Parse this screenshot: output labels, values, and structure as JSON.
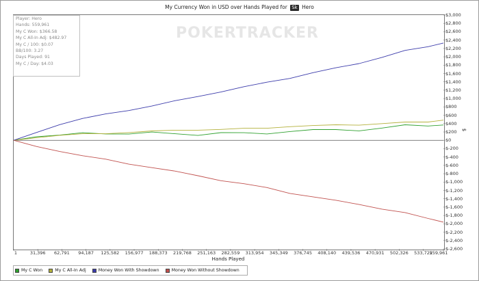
{
  "window": {
    "title_prefix": "My Currency Won in USD over Hands Played for",
    "site_badge": "Sk",
    "title_suffix": "Hero"
  },
  "watermark": "POKERTRACKER",
  "stats": [
    "Player: Hero",
    "Hands: 559,961",
    "My C Won: $366.58",
    "My C All-In Adj: $482.97",
    "My C / 100: $0.07",
    "BB/100: 3.27",
    "Days Played: 91",
    "My C / Day: $4.03"
  ],
  "chart_data": {
    "type": "line",
    "title": "My Currency Won in USD over Hands Played for Sk Hero",
    "xlabel": "Hands Played",
    "ylabel": "$",
    "xlim": [
      1,
      559961
    ],
    "ylim": [
      -2600,
      3000
    ],
    "x_ticks": [
      "1",
      "31,396",
      "62,791",
      "94,187",
      "125,582",
      "156,977",
      "188,373",
      "219,768",
      "251,163",
      "282,559",
      "313,954",
      "345,349",
      "376,745",
      "408,140",
      "439,536",
      "470,931",
      "502,326",
      "533,722",
      "559,961"
    ],
    "y_ticks": [
      "$3,000",
      "$2,800",
      "$2,600",
      "$2,400",
      "$2,200",
      "$2,000",
      "$1,800",
      "$1,600",
      "$1,400",
      "$1,200",
      "$1,000",
      "$800",
      "$600",
      "$400",
      "$200",
      "$0",
      "$-200",
      "$-400",
      "$-600",
      "$-800",
      "$-1,000",
      "$-1,200",
      "$-1,400",
      "$-1,600",
      "$-1,800",
      "$-2,000",
      "$-2,200",
      "$-2,400",
      "$-2,600"
    ],
    "grid": false,
    "legend_position": "bottom-left",
    "series": [
      {
        "name": "My C Won",
        "color": "#2ea02e",
        "x": [
          1,
          30000,
          60000,
          90000,
          120000,
          150000,
          180000,
          210000,
          240000,
          270000,
          300000,
          330000,
          360000,
          390000,
          420000,
          450000,
          480000,
          510000,
          540000,
          559961
        ],
        "y": [
          0,
          90,
          120,
          170,
          160,
          150,
          190,
          170,
          120,
          180,
          170,
          160,
          210,
          250,
          270,
          230,
          290,
          360,
          350,
          367
        ]
      },
      {
        "name": "My C All-In Adj",
        "color": "#b3b03a",
        "x": [
          1,
          30000,
          60000,
          90000,
          120000,
          150000,
          180000,
          210000,
          240000,
          270000,
          300000,
          330000,
          360000,
          390000,
          420000,
          450000,
          480000,
          510000,
          540000,
          559961
        ],
        "y": [
          0,
          70,
          120,
          150,
          170,
          190,
          220,
          230,
          250,
          260,
          280,
          300,
          330,
          350,
          360,
          370,
          400,
          430,
          450,
          483
        ]
      },
      {
        "name": "Money Won With Showdown",
        "color": "#3a3aaa",
        "x": [
          1,
          30000,
          60000,
          90000,
          120000,
          150000,
          180000,
          210000,
          240000,
          270000,
          300000,
          330000,
          360000,
          390000,
          420000,
          450000,
          480000,
          510000,
          540000,
          559961
        ],
        "y": [
          0,
          200,
          380,
          520,
          620,
          720,
          820,
          940,
          1060,
          1160,
          1280,
          1380,
          1490,
          1620,
          1730,
          1850,
          1990,
          2150,
          2230,
          2330
        ]
      },
      {
        "name": "Money Won Without Showdown",
        "color": "#c0504d",
        "x": [
          1,
          30000,
          60000,
          90000,
          120000,
          150000,
          180000,
          210000,
          240000,
          270000,
          300000,
          330000,
          360000,
          390000,
          420000,
          450000,
          480000,
          510000,
          540000,
          559961
        ],
        "y": [
          0,
          -160,
          -260,
          -370,
          -460,
          -560,
          -650,
          -740,
          -860,
          -960,
          -1040,
          -1140,
          -1260,
          -1350,
          -1440,
          -1550,
          -1640,
          -1730,
          -1880,
          -1960
        ]
      }
    ]
  }
}
